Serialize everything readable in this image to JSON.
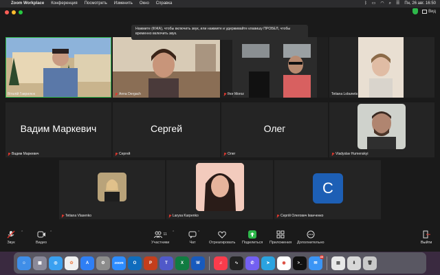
{
  "menubar": {
    "app_menu": [
      "Zoom Workplace",
      "Конференция",
      "Посмотреть",
      "Изменить",
      "Окно",
      "Справка"
    ],
    "datetime": "Пн, 26 авг.  16:50"
  },
  "titlebar": {
    "view_label": "Вид"
  },
  "notification": {
    "text": "Нажмите (ФЖА), чтобы включить звук, или нажмите и удерживайте клавишу ПРОБЕЛ, чтобы временно включить звук."
  },
  "participants": [
    {
      "name": "Віталій Гаврилюк",
      "type": "video",
      "active": true,
      "muted": false
    },
    {
      "name": "Anna Dergach",
      "type": "video",
      "muted": true
    },
    {
      "name": "Ihor Moroz",
      "type": "video",
      "muted": true
    },
    {
      "name": "Tetiana Lobunets",
      "type": "video",
      "muted": false
    },
    {
      "name": "Вадим Маркевич",
      "display": "Вадим Маркевич",
      "type": "name",
      "muted": true
    },
    {
      "name": "Сергей",
      "display": "Сергей",
      "type": "name",
      "muted": true
    },
    {
      "name": "Олег",
      "display": "Олег",
      "type": "name",
      "muted": true
    },
    {
      "name": "Vladyslav Humenskyi",
      "type": "photo",
      "muted": true
    },
    {
      "name": "Tetiana Vlasenko",
      "type": "photo",
      "muted": true
    },
    {
      "name": "Larysa Karpenko",
      "type": "photo",
      "muted": true
    },
    {
      "name": "Сергій Олегович Іванченко",
      "type": "letter",
      "letter": "С",
      "muted": true
    }
  ],
  "toolbar": {
    "audio": "Звук",
    "video": "Видео",
    "participants": "Участники",
    "participants_count": "11",
    "chat": "Чат",
    "react": "Отреагировать",
    "share": "Поделиться",
    "apps": "Приложения",
    "more": "Дополнительно",
    "leave": "Выйти"
  },
  "dock": {
    "apps": [
      "finder",
      "launchpad",
      "safari",
      "photos",
      "app-store",
      "system-settings",
      "zoom",
      "outlook",
      "powerpoint",
      "teams",
      "excel",
      "word",
      "music",
      "activity-monitor",
      "viber",
      "telegram",
      "chrome",
      "terminal",
      "mail",
      "preview",
      "downloads",
      "trash"
    ],
    "mail_badge": "40",
    "zoom_label": "zoom"
  },
  "colors": {
    "active_border": "#2eb84b",
    "mute_red": "#e0382f",
    "share_green": "#2eb84b",
    "avatar_blue": "#1d5fb5"
  }
}
